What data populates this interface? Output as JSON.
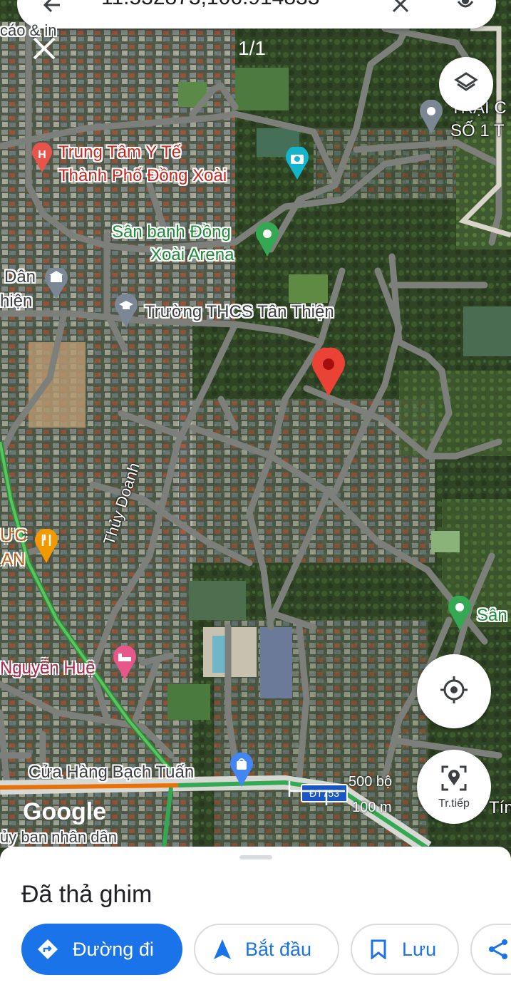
{
  "search": {
    "coords_text": "11.532873,106.914833"
  },
  "photo_counter": "1/1",
  "map": {
    "labels": {
      "cao_and_in": "cáo & in",
      "hospital_line1": "Trung Tâm Y Tế",
      "hospital_line2": "Thành Phố Đồng Xoài",
      "arena_line1": "Sân banh Đồng",
      "arena_line2": "Xoài Arena",
      "dan_thien_1": "Dân",
      "dan_thien_2": "hiện",
      "school": "Trường THCS Tân Thiện",
      "trai_line1": "TRẠI C",
      "trai_line2": "SỐ 1 T",
      "thuy_doanh": "Thủy Doanh",
      "thuc_an_1": "ỰC",
      "thuc_an_2": "AN",
      "san": "Sân",
      "nguyen_hue": "Nguyễn Huệ",
      "cua_hang": "Cửa Hàng Bạch Tuấn",
      "road_badge": "ĐT753",
      "uy_ban": "ủy ban nhân dân",
      "tin": "Tín",
      "google": "Google"
    },
    "scale": {
      "top": "500 bộ",
      "bottom": "100 m"
    }
  },
  "buttons": {
    "layers": "layers",
    "my_location": "my-location",
    "explore_label": "Tr.tiếp"
  },
  "sheet": {
    "title": "Đã thả ghim",
    "directions": "Đường đi",
    "start": "Bắt đầu",
    "save": "Lưu"
  },
  "colors": {
    "accent": "#1a73e8",
    "pin": "#ea4335",
    "traffic_green": "#34a853",
    "traffic_orange": "#e8710a"
  }
}
